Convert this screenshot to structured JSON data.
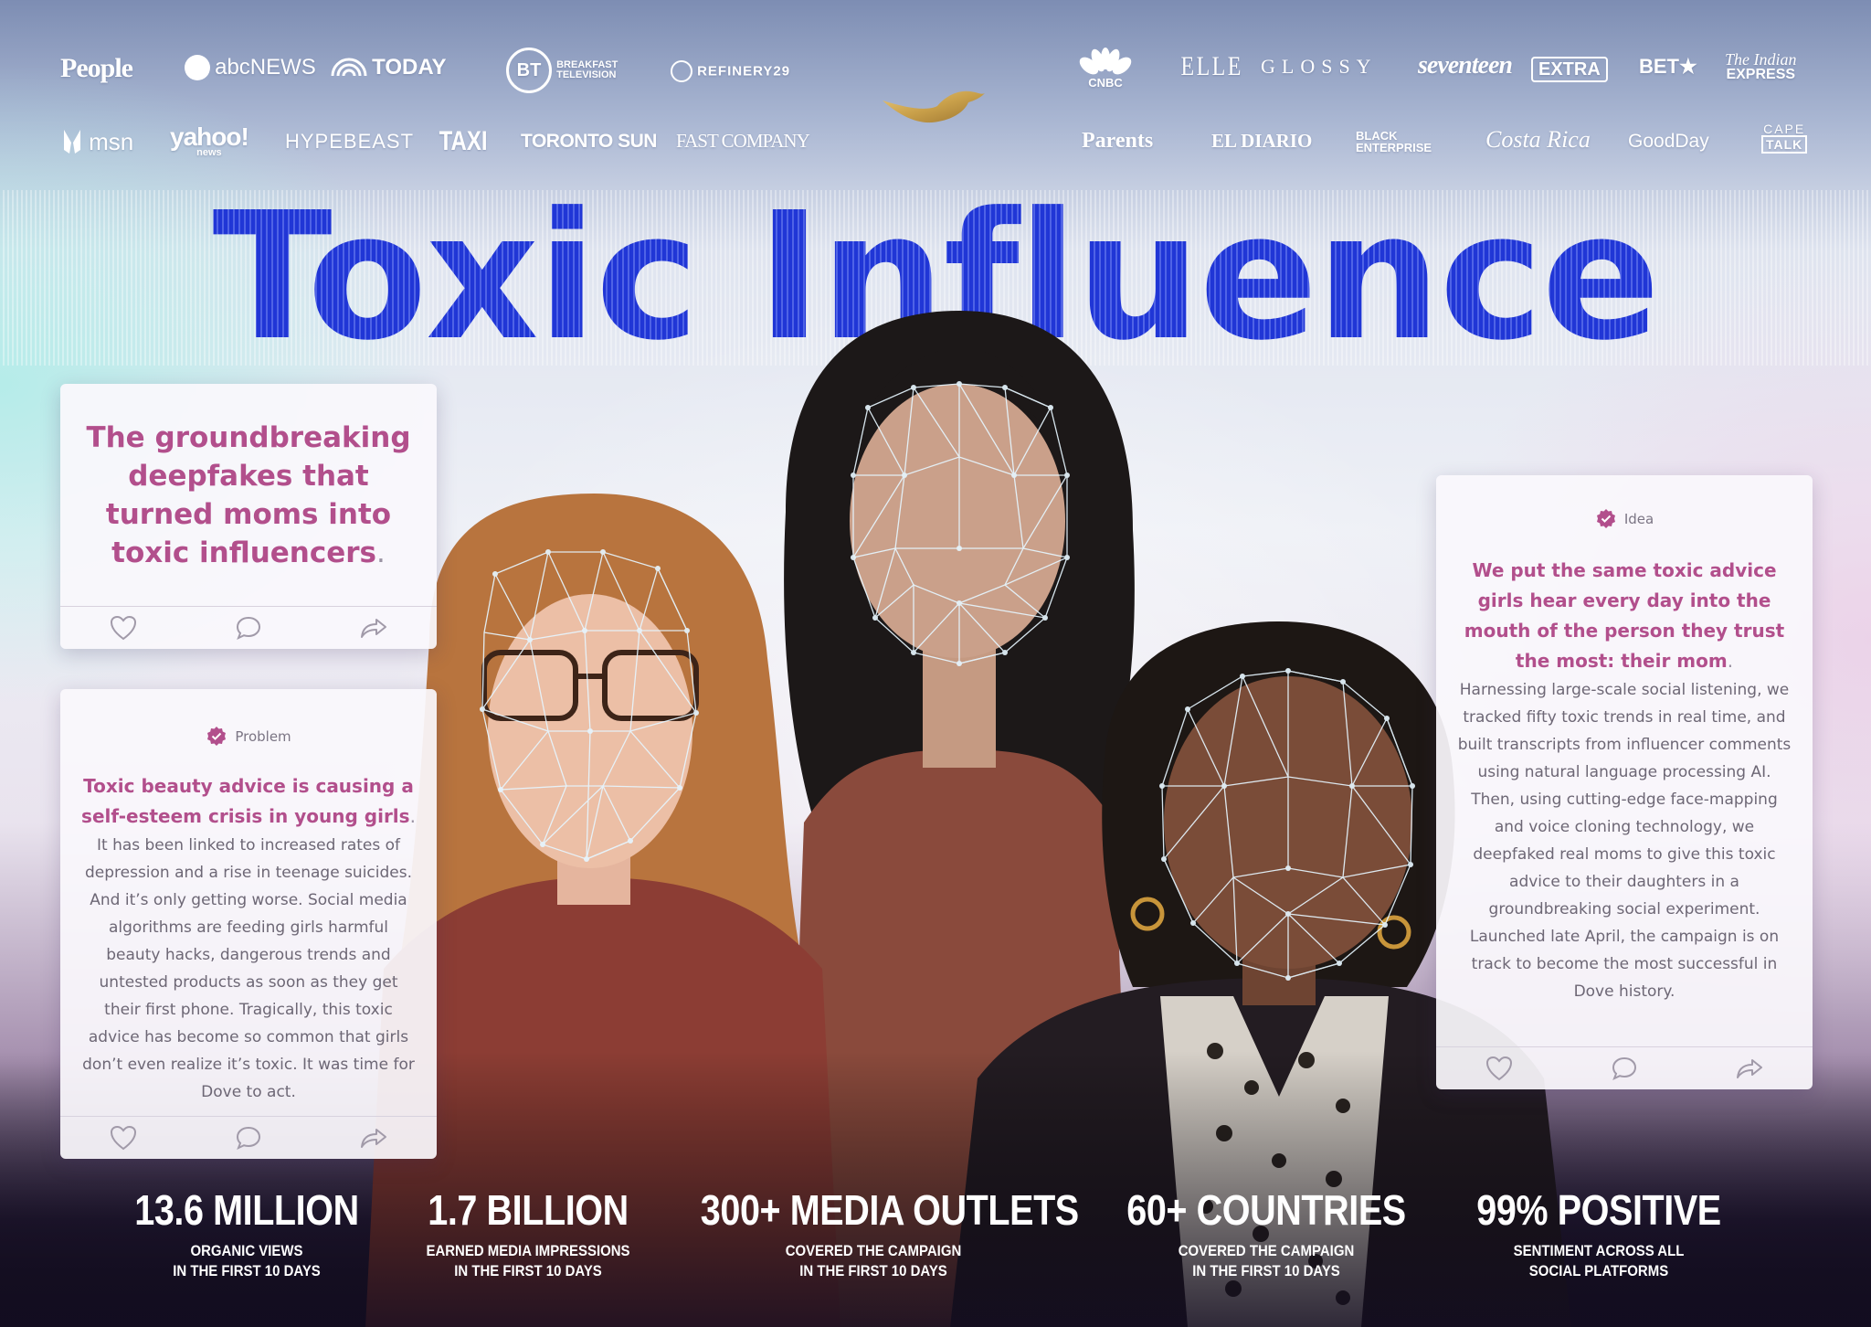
{
  "logos_top_left": [
    "People",
    "abcNEWS",
    "TODAY",
    "BT",
    "BREAKFAST",
    "TELEVISION",
    "REFINERY29"
  ],
  "logos_top_right": [
    "CNBC",
    "ELLE",
    "GLOSSY",
    "seventeen",
    "EXTRA",
    "BET",
    "The Indian",
    "EXPRESS"
  ],
  "logos_second_left": [
    "msn",
    "yahoo!",
    "news",
    "HYPEBEAST",
    "TAXI",
    "TORONTO SUN",
    "FAST COMPANY"
  ],
  "logos_second_right": [
    "Parents",
    "EL DIARIO",
    "BLACK",
    "ENTERPRISE",
    "Costa Rica",
    "GoodDay",
    "CAPE",
    "TALK"
  ],
  "headline": "Toxic Influence",
  "intro_card": {
    "text": "The groundbreaking deepfakes that turned moms into toxic influencers",
    "period": "."
  },
  "problem_card": {
    "tag": "Problem",
    "lead": "Toxic beauty advice is causing a self-esteem crisis in young girls",
    "period": ".",
    "body": "It has been linked to increased rates of depression and a rise in teenage suicides. And it’s only getting worse. Social media algorithms are feeding girls harmful beauty hacks, dangerous trends and untested products as soon as they get their first phone. Tragically, this toxic advice has become so common that girls don’t even realize it’s toxic. It was time for Dove to act."
  },
  "idea_card": {
    "tag": "Idea",
    "lead": "We put the same toxic advice girls hear every day into the mouth of the person they trust the most: their mom",
    "period": ".",
    "body": "Harnessing large-scale social listening, we tracked fifty toxic trends in real time, and built transcripts from influencer comments using natural language processing AI. Then, using cutting-edge face-mapping and voice cloning technology, we deepfaked real moms to give this toxic advice to their daughters in a groundbreaking social experiment. Launched late April, the campaign is on track to become the most successful in Dove history."
  },
  "card_icons": [
    "heart-icon",
    "comment-icon",
    "share-icon"
  ],
  "stats": [
    {
      "value": "13.6 MILLION",
      "line1": "ORGANIC VIEWS",
      "line2": "IN THE FIRST 10 DAYS"
    },
    {
      "value": "1.7 BILLION",
      "line1": "EARNED MEDIA IMPRESSIONS",
      "line2": "IN THE FIRST 10 DAYS"
    },
    {
      "value": "300+ MEDIA OUTLETS",
      "line1": "COVERED THE CAMPAIGN",
      "line2": "IN THE FIRST 10 DAYS"
    },
    {
      "value": "60+ COUNTRIES",
      "line1": "COVERED THE CAMPAIGN",
      "line2": "IN THE FIRST 10 DAYS"
    },
    {
      "value": "99% POSITIVE",
      "line1": "SENTIMENT ACROSS ALL",
      "line2": "SOCIAL PLATFORMS"
    }
  ],
  "colors": {
    "headline": "#2a3fd0",
    "accent_pink": "#b24f8c",
    "body_text": "#6d6775",
    "dove_gold": "#c9a04a"
  }
}
